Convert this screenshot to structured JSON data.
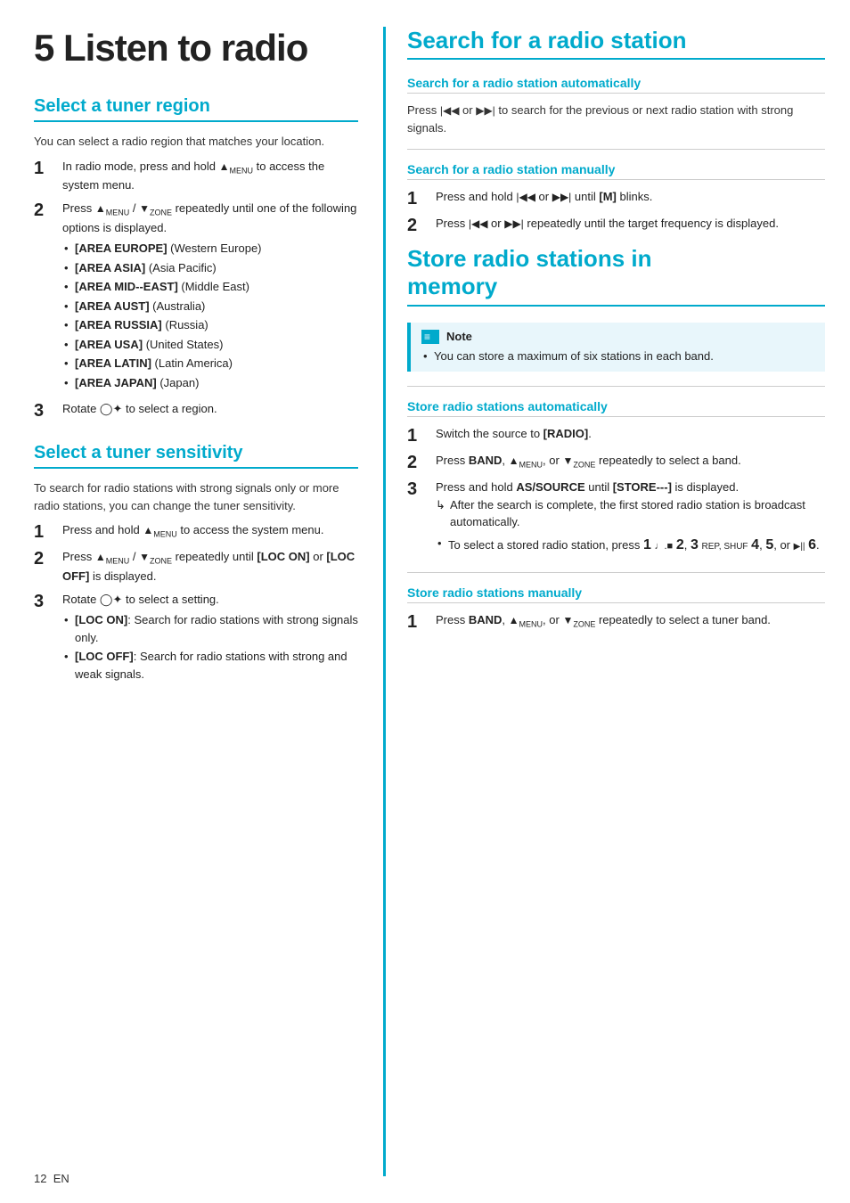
{
  "page": {
    "chapter_num": "5",
    "chapter_title": "Listen to radio",
    "footer_page": "12",
    "footer_lang": "EN"
  },
  "left": {
    "tuner_region": {
      "title": "Select a tuner region",
      "intro": "You can select a radio region that matches your location.",
      "steps": [
        {
          "num": "1",
          "text": "In radio mode, press and hold",
          "icon": "MENU",
          "text2": "to access the system menu."
        },
        {
          "num": "2",
          "text": "Press",
          "icon": "MENU/ZONE",
          "text2": "repeatedly until one of the following options is displayed.",
          "bullets": [
            "[AREA EUROPE] (Western Europe)",
            "[AREA ASIA] (Asia Pacific)",
            "[AREA MID--EAST] (Middle East)",
            "[AREA AUST] (Australia)",
            "[AREA RUSSIA] (Russia)",
            "[AREA USA] (United States)",
            "[AREA LATIN] (Latin America)",
            "[AREA JAPAN] (Japan)"
          ]
        },
        {
          "num": "3",
          "text": "Rotate",
          "icon": "⊙✿",
          "text2": "to select a region."
        }
      ]
    },
    "tuner_sensitivity": {
      "title": "Select a tuner sensitivity",
      "intro": "To search for radio stations with strong signals only or more radio stations, you can change the tuner sensitivity.",
      "steps": [
        {
          "num": "1",
          "text": "Press and hold",
          "icon": "MENU",
          "text2": "to access the system menu."
        },
        {
          "num": "2",
          "text": "Press",
          "icon": "MENU / ZONE",
          "text2": "repeatedly until [LOC ON] or [LOC OFF] is displayed."
        },
        {
          "num": "3",
          "text": "Rotate",
          "icon": "⊙✿",
          "text2": "to select a setting.",
          "bullets": [
            "[LOC ON]: Search for radio stations with strong signals only.",
            "[LOC OFF]: Search for radio stations with strong and weak signals."
          ]
        }
      ]
    }
  },
  "right": {
    "search_section": {
      "title": "Search for a radio station",
      "automatically": {
        "subtitle": "Search for a radio station automatically",
        "text": "Press",
        "icon_prev": "◀◀",
        "or": "or",
        "icon_next": "▶▶|",
        "text2": "to search for the previous or next radio station with strong signals."
      },
      "manually": {
        "subtitle": "Search for a radio station manually",
        "steps": [
          {
            "num": "1",
            "text": "Press and hold",
            "icon_prev": "◀◀",
            "or": "or",
            "icon_next": "▶▶|",
            "text2": "until [M] blinks."
          },
          {
            "num": "2",
            "text": "Press",
            "icon_prev": "◀◀",
            "or": "or",
            "icon_next": "▶▶|",
            "text2": "repeatedly until the target frequency is displayed."
          }
        ]
      }
    },
    "store_memory": {
      "title": "Store radio stations in memory",
      "note": {
        "header": "Note",
        "bullets": [
          "You can store a maximum of six stations in each band."
        ]
      },
      "automatically": {
        "subtitle": "Store radio stations automatically",
        "steps": [
          {
            "num": "1",
            "text": "Switch the source to [RADIO]."
          },
          {
            "num": "2",
            "text": "Press BAND,",
            "icon": "▲MENU",
            "or": "or",
            "icon2": "▼ZONE",
            "text2": "repeatedly to select a band."
          },
          {
            "num": "3",
            "text": "Press and hold AS/SOURCE until [STORE---] is displayed.",
            "arrow": "After the search is complete, the first stored radio station is broadcast automatically.",
            "bullet": "To select a stored radio station, press 1 ♩.■ 2, 3 REP, SHUF 4, 5, or ▶|| 6."
          }
        ]
      },
      "manually": {
        "subtitle": "Store radio stations manually",
        "steps": [
          {
            "num": "1",
            "text": "Press BAND,",
            "icon": "▲MENU",
            "or": "or",
            "icon2": "▼ZONE",
            "text2": "repeatedly to select a tuner band."
          }
        ]
      }
    }
  }
}
